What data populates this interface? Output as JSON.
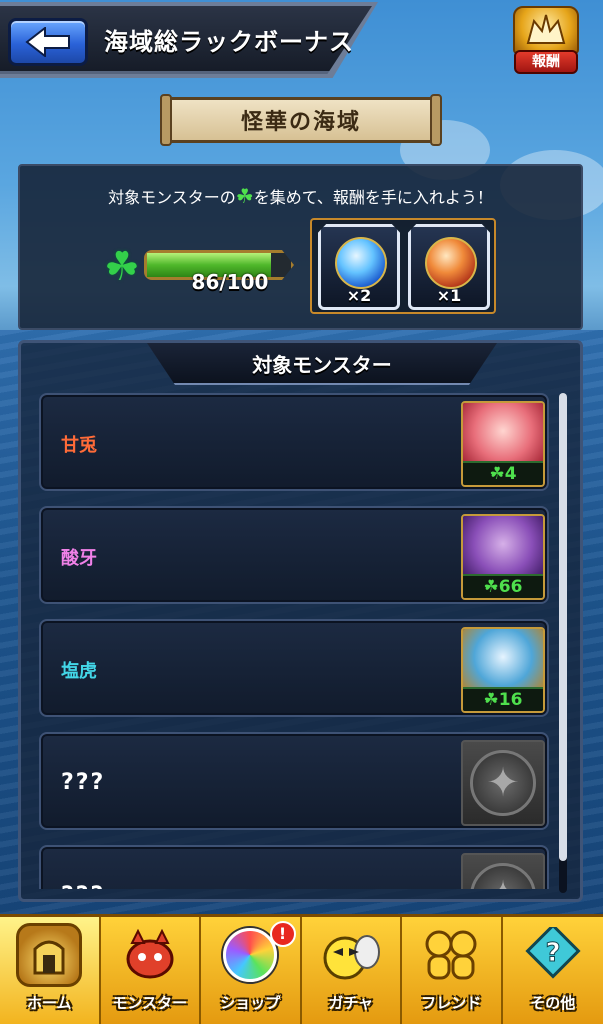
{
  "header": {
    "title": "海域総ラックボーナス",
    "reward_label": "報酬"
  },
  "banner": {
    "title": "怪華の海域"
  },
  "info": {
    "instruction_prefix": "対象モンスターの",
    "instruction_clover": "☘",
    "instruction_suffix": "を集めて、報酬を手に入れよう！",
    "progress_text": "86/100",
    "progress_fraction": 0.86,
    "rewards": [
      {
        "icon": "blue-orb-icon",
        "quantity": "×2"
      },
      {
        "icon": "red-orb-icon",
        "quantity": "×1"
      }
    ]
  },
  "list": {
    "tab_label": "対象モンスター",
    "rows": [
      {
        "name": "甘兎",
        "luck": "☘4",
        "art_color": "#e86e7a"
      },
      {
        "name": "酸牙",
        "luck": "☘66",
        "art_color": "#8a4fb8"
      },
      {
        "name": "塩虎",
        "luck": "☘16",
        "art_color": "#4fa6d8"
      },
      {
        "name": "???",
        "locked": true
      },
      {
        "name": "???",
        "locked": true
      }
    ]
  },
  "nav": {
    "items": [
      {
        "label": "ホーム"
      },
      {
        "label": "モンスター"
      },
      {
        "label": "ショップ",
        "badge": "!"
      },
      {
        "label": "ガチャ"
      },
      {
        "label": "フレンド"
      },
      {
        "label": "その他"
      }
    ]
  },
  "colors": {
    "accent_gold": "#e6a51a",
    "clover_green": "#4fe04d",
    "panel_bg": "#14213a"
  }
}
